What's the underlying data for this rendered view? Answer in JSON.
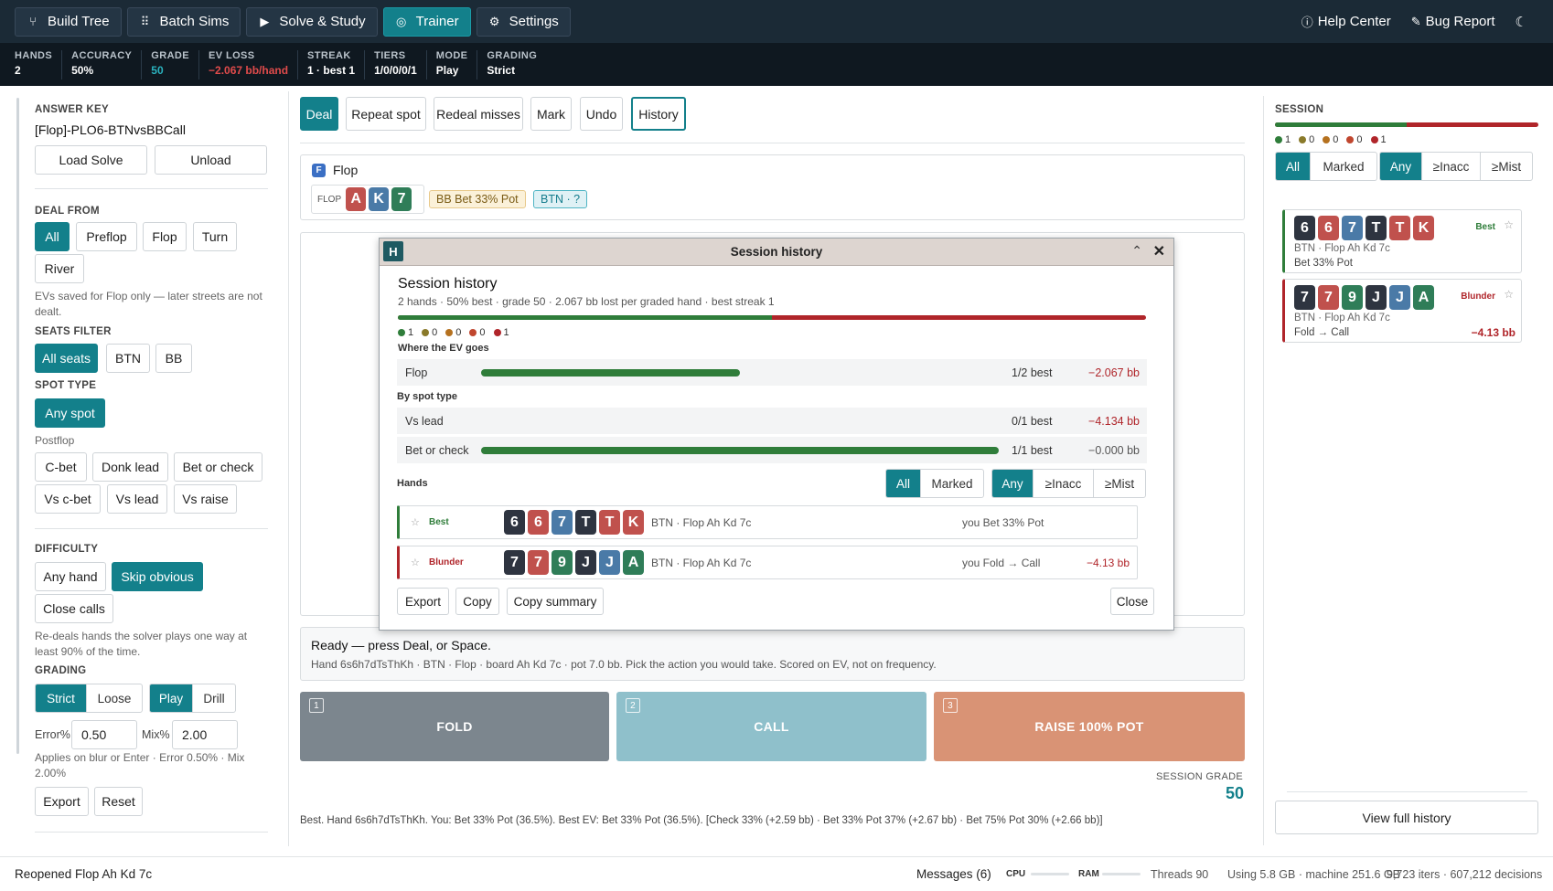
{
  "nav": {
    "items": [
      {
        "label": "Build Tree",
        "icon": "tree-icon",
        "active": false
      },
      {
        "label": "Batch Sims",
        "icon": "grid-icon",
        "active": false
      },
      {
        "label": "Solve & Study",
        "icon": "play-icon",
        "active": false
      },
      {
        "label": "Trainer",
        "icon": "target-icon",
        "active": true
      },
      {
        "label": "Settings",
        "icon": "gear-icon",
        "active": false
      }
    ],
    "help": "Help Center",
    "bug": "Bug Report"
  },
  "stats": [
    {
      "label": "HANDS",
      "value": "2"
    },
    {
      "label": "ACCURACY",
      "value": "50%"
    },
    {
      "label": "GRADE",
      "value": "50"
    },
    {
      "label": "EV LOSS",
      "value": "−2.067 bb/hand"
    },
    {
      "label": "STREAK",
      "value": "1 · best 1"
    },
    {
      "label": "TIERS",
      "value": "1/0/0/0/1"
    },
    {
      "label": "MODE",
      "value": "Play"
    },
    {
      "label": "GRADING",
      "value": "Strict"
    }
  ],
  "left": {
    "answer_key_label": "ANSWER KEY",
    "answer_key": "[Flop]-PLO6-BTNvsBBCall",
    "load": "Load Solve",
    "unload": "Unload",
    "deal_from_label": "DEAL FROM",
    "deal_from": [
      "All",
      "Preflop",
      "Flop",
      "Turn",
      "River"
    ],
    "deal_note": "EVs saved for Flop only — later streets are not dealt.",
    "seats_label": "SEATS FILTER",
    "seats": [
      "All seats",
      "BTN",
      "BB"
    ],
    "spot_label": "SPOT TYPE",
    "any_spot": "Any spot",
    "postflop_label": "Postflop",
    "spots": [
      "C-bet",
      "Donk lead",
      "Bet or check",
      "Vs c-bet",
      "Vs lead",
      "Vs raise"
    ],
    "difficulty_label": "DIFFICULTY",
    "difficulty": [
      "Any hand",
      "Skip obvious",
      "Close calls"
    ],
    "difficulty_note": "Re-deals hands the solver plays one way at least 90% of the time.",
    "grading_label": "GRADING",
    "grading": [
      "Strict",
      "Loose"
    ],
    "mode": [
      "Play",
      "Drill"
    ],
    "error_label": "Error%",
    "error_value": "0.50",
    "mix_label": "Mix%",
    "mix_value": "2.00",
    "apply_note": "Applies on blur or Enter · Error 0.50% · Mix 2.00%",
    "export": "Export",
    "reset": "Reset"
  },
  "toolbar": {
    "items": [
      "Deal",
      "Repeat spot",
      "Redeal misses",
      "Mark",
      "Undo",
      "History"
    ]
  },
  "street": {
    "badge": "F",
    "name": "Flop",
    "board_label": "FLOP",
    "board": [
      {
        "r": "A",
        "c": "red"
      },
      {
        "r": "K",
        "c": "blue"
      },
      {
        "r": "7",
        "c": "green"
      }
    ],
    "bb_tag": "BB  Bet 33% Pot",
    "btn_tag": "BTN · ?"
  },
  "status": {
    "title": "Ready — press Deal, or Space.",
    "detail": "Hand 6s6h7dTsThKh · BTN · Flop · board Ah Kd 7c · pot 7.0 bb. Pick the action you would take. Scored on EV, not on frequency."
  },
  "actions": [
    {
      "num": "1",
      "label": "FOLD",
      "color": "#7c868e"
    },
    {
      "num": "2",
      "label": "CALL",
      "color": "#8fc0cb"
    },
    {
      "num": "3",
      "label": "RAISE 100% POT",
      "color": "#d99375"
    }
  ],
  "session_grade": {
    "label": "SESSION GRADE",
    "value": "50"
  },
  "result_line": "Best. Hand 6s6h7dTsThKh. You: Bet 33% Pot (36.5%). Best EV: Bet 33% Pot (36.5%). [Check 33% (+2.59 bb) · Bet 33% Pot 37% (+2.67 bb) · Bet 75% Pot 30% (+2.66 bb)]",
  "modal": {
    "window_title": "Session history",
    "heading": "Session history",
    "summary": "2 hands · 50% best · grade 50 · 2.067 bb lost per graded hand · best streak 1",
    "tier_fraction_best": 0.5,
    "tiers": [
      {
        "n": "1",
        "color": "#2f7d3a"
      },
      {
        "n": "0",
        "color": "#8a7a2a"
      },
      {
        "n": "0",
        "color": "#b5711f"
      },
      {
        "n": "0",
        "color": "#c0462e"
      },
      {
        "n": "1",
        "color": "#b0252a"
      }
    ],
    "ev_label": "Where the EV goes",
    "ev_rows": [
      {
        "name": "Flop",
        "fraction": 0.5,
        "best": "1/2 best",
        "loss": "−2.067 bb"
      }
    ],
    "spot_label": "By spot type",
    "spot_rows": [
      {
        "name": "Vs lead",
        "fraction": 0,
        "best": "0/1 best",
        "loss": "−4.134 bb"
      },
      {
        "name": "Bet or check",
        "fraction": 1,
        "best": "1/1 best",
        "loss": "−0.000 bb"
      }
    ],
    "hands_label": "Hands",
    "filter1": [
      "All",
      "Marked"
    ],
    "filter2": [
      "Any",
      "≥Inacc",
      "≥Mist"
    ],
    "hands": [
      {
        "tier": "Best",
        "tier_color": "#2f7d3a",
        "cards": [
          {
            "r": "6",
            "c": "dark"
          },
          {
            "r": "6",
            "c": "red"
          },
          {
            "r": "7",
            "c": "blue"
          },
          {
            "r": "T",
            "c": "dark"
          },
          {
            "r": "T",
            "c": "red"
          },
          {
            "r": "K",
            "c": "red"
          }
        ],
        "info": "BTN · Flop Ah Kd 7c",
        "you": "you Bet 33% Pot",
        "loss": ""
      },
      {
        "tier": "Blunder",
        "tier_color": "#b0252a",
        "cards": [
          {
            "r": "7",
            "c": "dark"
          },
          {
            "r": "7",
            "c": "red"
          },
          {
            "r": "9",
            "c": "green"
          },
          {
            "r": "J",
            "c": "dark"
          },
          {
            "r": "J",
            "c": "blue"
          },
          {
            "r": "A",
            "c": "green"
          }
        ],
        "info": "BTN · Flop Ah Kd 7c",
        "you": "you Fold → Call",
        "loss": "−4.13 bb"
      }
    ],
    "export": "Export",
    "copy": "Copy",
    "copy_summary": "Copy summary",
    "close": "Close"
  },
  "right": {
    "label": "SESSION",
    "tier_fraction_best": 0.5,
    "tiers": [
      {
        "n": "1",
        "color": "#2f7d3a"
      },
      {
        "n": "0",
        "color": "#8a7a2a"
      },
      {
        "n": "0",
        "color": "#b5711f"
      },
      {
        "n": "0",
        "color": "#c0462e"
      },
      {
        "n": "1",
        "color": "#b0252a"
      }
    ],
    "filter1": [
      "All",
      "Marked"
    ],
    "filter2": [
      "Any",
      "≥Inacc",
      "≥Mist"
    ],
    "hands": [
      {
        "tier": "Best",
        "tier_color": "#2f7d3a",
        "cards": [
          {
            "r": "6",
            "c": "dark"
          },
          {
            "r": "6",
            "c": "red"
          },
          {
            "r": "7",
            "c": "blue"
          },
          {
            "r": "T",
            "c": "dark"
          },
          {
            "r": "T",
            "c": "red"
          },
          {
            "r": "K",
            "c": "red"
          }
        ],
        "line1": "BTN · Flop Ah Kd 7c",
        "line2": "Bet 33% Pot",
        "loss": ""
      },
      {
        "tier": "Blunder",
        "tier_color": "#b0252a",
        "cards": [
          {
            "r": "7",
            "c": "dark"
          },
          {
            "r": "7",
            "c": "red"
          },
          {
            "r": "9",
            "c": "green"
          },
          {
            "r": "J",
            "c": "dark"
          },
          {
            "r": "J",
            "c": "blue"
          },
          {
            "r": "A",
            "c": "green"
          }
        ],
        "line1": "BTN · Flop Ah Kd 7c",
        "line2": "Fold → Call",
        "loss": "−4.13 bb"
      }
    ],
    "view_full": "View full history"
  },
  "footer": {
    "left": "Reopened Flop Ah Kd 7c",
    "messages": "Messages (6)",
    "cpu": "CPU",
    "ram": "RAM",
    "threads": "Threads 90",
    "using": "Using 5.8 GB · machine 251.6 GB",
    "iters": "9,723 iters · 607,212 decisions"
  }
}
